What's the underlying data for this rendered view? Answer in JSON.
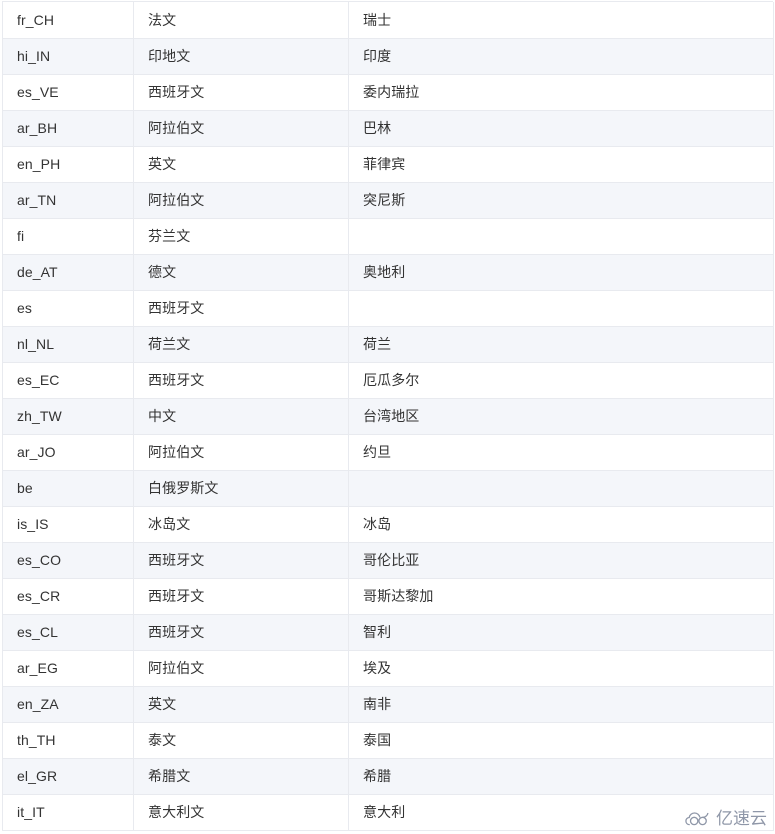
{
  "table": {
    "columns": [
      {
        "key": "code",
        "name": "locale-code-column"
      },
      {
        "key": "language",
        "name": "language-column"
      },
      {
        "key": "region",
        "name": "region-column"
      }
    ],
    "rows": [
      {
        "code": "fr_CH",
        "language": "法文",
        "region": "瑞士"
      },
      {
        "code": "hi_IN",
        "language": "印地文",
        "region": "印度"
      },
      {
        "code": "es_VE",
        "language": "西班牙文",
        "region": "委内瑞拉"
      },
      {
        "code": "ar_BH",
        "language": "阿拉伯文",
        "region": "巴林"
      },
      {
        "code": "en_PH",
        "language": "英文",
        "region": "菲律宾"
      },
      {
        "code": "ar_TN",
        "language": "阿拉伯文",
        "region": "突尼斯"
      },
      {
        "code": "fi",
        "language": "芬兰文",
        "region": ""
      },
      {
        "code": "de_AT",
        "language": "德文",
        "region": "奥地利"
      },
      {
        "code": "es",
        "language": "西班牙文",
        "region": ""
      },
      {
        "code": "nl_NL",
        "language": "荷兰文",
        "region": "荷兰"
      },
      {
        "code": "es_EC",
        "language": "西班牙文",
        "region": "厄瓜多尔"
      },
      {
        "code": "zh_TW",
        "language": "中文",
        "region": "台湾地区"
      },
      {
        "code": "ar_JO",
        "language": "阿拉伯文",
        "region": "约旦"
      },
      {
        "code": "be",
        "language": "白俄罗斯文",
        "region": ""
      },
      {
        "code": "is_IS",
        "language": "冰岛文",
        "region": "冰岛"
      },
      {
        "code": "es_CO",
        "language": "西班牙文",
        "region": "哥伦比亚"
      },
      {
        "code": "es_CR",
        "language": "西班牙文",
        "region": "哥斯达黎加"
      },
      {
        "code": "es_CL",
        "language": "西班牙文",
        "region": "智利"
      },
      {
        "code": "ar_EG",
        "language": "阿拉伯文",
        "region": "埃及"
      },
      {
        "code": "en_ZA",
        "language": "英文",
        "region": "南非"
      },
      {
        "code": "th_TH",
        "language": "泰文",
        "region": "泰国"
      },
      {
        "code": "el_GR",
        "language": "希腊文",
        "region": "希腊"
      },
      {
        "code": "it_IT",
        "language": "意大利文",
        "region": "意大利"
      }
    ]
  },
  "watermark": {
    "text": "亿速云",
    "icon": "cloud-logo-icon",
    "color": "#8f97a8"
  },
  "style": {
    "stripe_color": "#f4f6fa",
    "row_color": "#ffffff",
    "border_color": "#e8eaef",
    "text_color": "#333333"
  }
}
